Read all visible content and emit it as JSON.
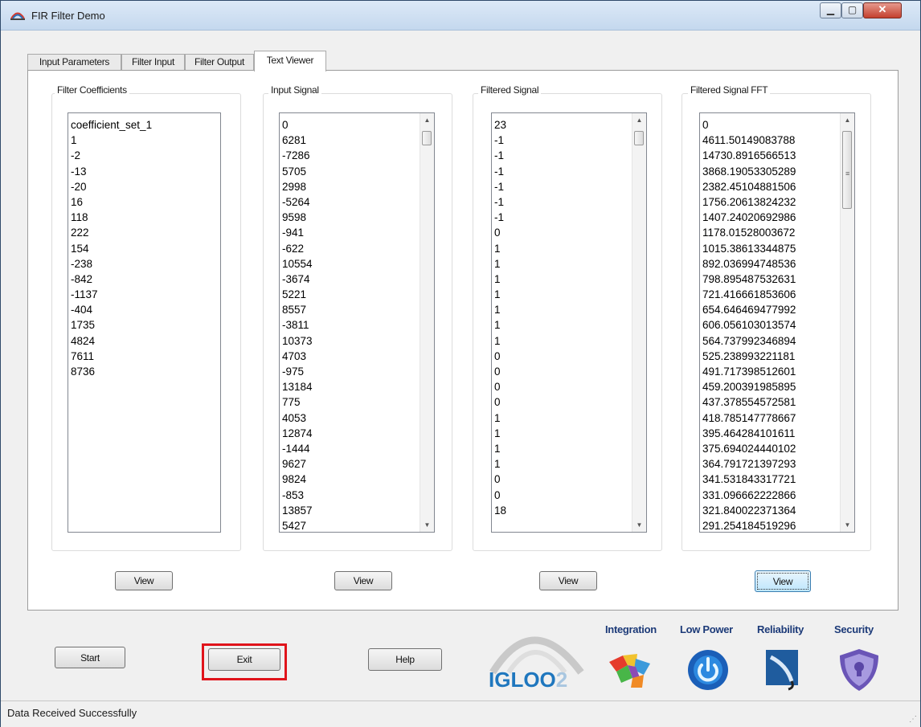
{
  "window": {
    "title": "FIR Filter Demo"
  },
  "tabs": [
    {
      "label": "Input Parameters",
      "active": false
    },
    {
      "label": "Filter Input",
      "active": false
    },
    {
      "label": "Filter Output",
      "active": false
    },
    {
      "label": "Text Viewer",
      "active": true
    }
  ],
  "groups": [
    {
      "title": "Filter Coefficients",
      "items": [
        "coefficient_set_1",
        "1",
        "-2",
        "-13",
        "-20",
        "16",
        "118",
        "222",
        "154",
        "-238",
        "-842",
        "-1137",
        "-404",
        "1735",
        "4824",
        "7611",
        "8736"
      ],
      "has_scrollbar": false,
      "view_label": "View"
    },
    {
      "title": "Input Signal",
      "items": [
        "0",
        "6281",
        "-7286",
        "5705",
        "2998",
        "-5264",
        "9598",
        "-941",
        "-622",
        "10554",
        "-3674",
        "5221",
        "8557",
        "-3811",
        "10373",
        "4703",
        "-975",
        "13184",
        "775",
        "4053",
        "12874",
        "-1444",
        "9627",
        "9824",
        "-853",
        "13857",
        "5427"
      ],
      "has_scrollbar": true,
      "view_label": "View"
    },
    {
      "title": "Filtered Signal",
      "items": [
        "23",
        "-1",
        "-1",
        "-1",
        "-1",
        "-1",
        "-1",
        "0",
        "1",
        "1",
        "1",
        "1",
        "1",
        "1",
        "1",
        "0",
        "0",
        "0",
        "0",
        "1",
        "1",
        "1",
        "1",
        "0",
        "0",
        "18"
      ],
      "has_scrollbar": true,
      "view_label": "View"
    },
    {
      "title": "Filtered Signal FFT",
      "items": [
        "0",
        "4611.50149083788",
        "14730.8916566513",
        "3868.19053305289",
        "2382.45104881506",
        "1756.20613824232",
        "1407.24020692986",
        "1178.01528003672",
        "1015.38613344875",
        "892.036994748536",
        "798.895487532631",
        "721.416661853606",
        "654.646469477992",
        "606.056103013574",
        "564.737992346894",
        "525.238993221181",
        "491.717398512601",
        "459.200391985895",
        "437.378554572581",
        "418.785147778667",
        "395.464284101611",
        "375.694024440102",
        "364.791721397293",
        "341.531843317721",
        "331.096662222866",
        "321.840022371364",
        "291.254184519296"
      ],
      "has_scrollbar": true,
      "view_label": "View"
    }
  ],
  "buttons": {
    "start": "Start",
    "exit": "Exit",
    "help": "Help"
  },
  "branding": {
    "logo_main": "IGLOO",
    "logo_suffix": "2",
    "features": [
      "Integration",
      "Low Power",
      "Reliability",
      "Security"
    ]
  },
  "status": {
    "text": "Data Received Successfully"
  },
  "colors": {
    "accent_highlight": "#e0141b",
    "brand_blue": "#1f77be",
    "feature_text": "#1c3a78"
  },
  "icons": [
    "window-app-icon",
    "minimize-icon",
    "maximize-icon",
    "close-icon",
    "puzzle-icon",
    "power-icon",
    "reliability-icon",
    "shield-icon",
    "resize-grip-icon"
  ]
}
